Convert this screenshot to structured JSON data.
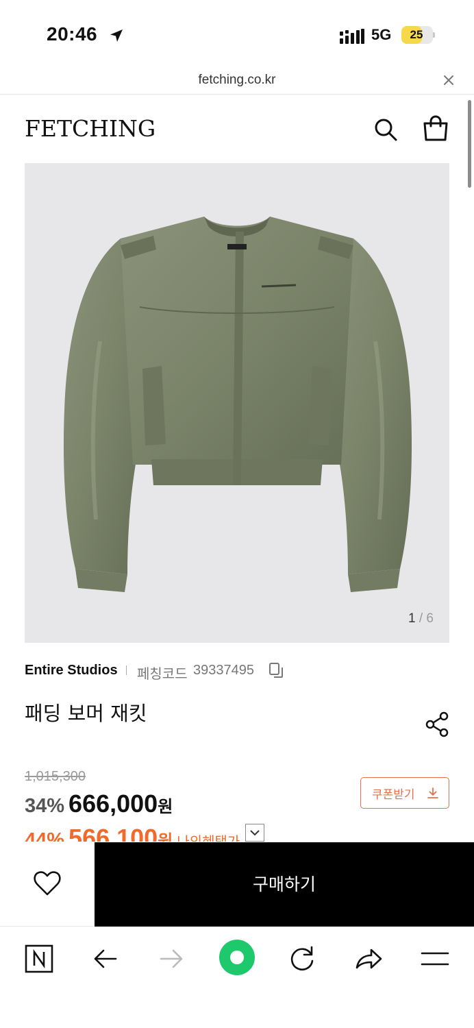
{
  "status_bar": {
    "time": "20:46",
    "network": "5G",
    "battery_level": "25",
    "battery_fraction": 0.25,
    "battery_color": "#f6d94a"
  },
  "browser": {
    "url": "fetching.co.kr"
  },
  "header": {
    "logo": "FETCHING"
  },
  "gallery": {
    "current": "1",
    "separator": "/",
    "total": "6"
  },
  "product": {
    "brand": "Entire Studios",
    "code_label": "페칭코드",
    "code_value": "39337495",
    "title": "패딩 보머 재킷"
  },
  "price": {
    "original": "1,015,300",
    "discount_rate": "34%",
    "sale_price": "666,000",
    "currency": "원",
    "benefit_rate": "44%",
    "benefit_price": "566,100",
    "benefit_label": "나의혜택가",
    "accent_color": "#f06a2c"
  },
  "coupon": {
    "label": "쿠폰받기"
  },
  "purchase": {
    "buy_label": "구매하기"
  },
  "icons": {
    "location": "location-arrow-icon",
    "signal": "signal-bars-icon",
    "close": "close-icon",
    "search": "search-icon",
    "bag": "shopping-bag-icon",
    "copy": "copy-icon",
    "share": "share-icon",
    "download": "download-icon",
    "chevron": "chevron-down-icon",
    "heart": "heart-icon",
    "naver": "naver-n-icon",
    "back": "back-arrow-icon",
    "forward": "forward-arrow-icon",
    "home": "green-circle-icon",
    "reload": "reload-icon",
    "send": "share-arrow-icon",
    "menu": "menu-icon"
  }
}
